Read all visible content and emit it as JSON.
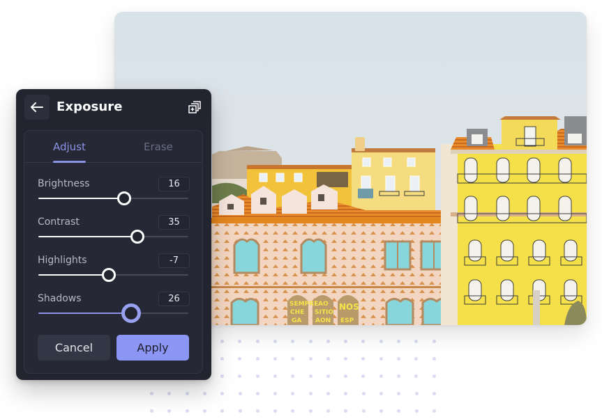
{
  "panel": {
    "title": "Exposure",
    "back_icon": "arrow-left-icon",
    "copy_icon": "duplicate-add-icon",
    "tabs": [
      {
        "label": "Adjust",
        "active": true
      },
      {
        "label": "Erase",
        "active": false
      }
    ],
    "sliders": [
      {
        "label": "Brightness",
        "value": "16",
        "position_pct": 57,
        "active": false
      },
      {
        "label": "Contrast",
        "value": "35",
        "position_pct": 66,
        "active": false
      },
      {
        "label": "Highlights",
        "value": "-7",
        "position_pct": 47,
        "active": false
      },
      {
        "label": "Shadows",
        "value": "26",
        "position_pct": 62,
        "active": true
      }
    ],
    "buttons": {
      "cancel": "Cancel",
      "apply": "Apply"
    }
  },
  "photo": {
    "description": "Colorful Lisbon building facades under pale sky",
    "sign_text": [
      "SEMPRE",
      "CHE",
      "GA",
      "AO",
      "SITIO",
      "AON",
      "NOS",
      "ESP"
    ]
  },
  "colors": {
    "accent": "#8c96f4",
    "panel_bg": "#22242f",
    "inner_bg": "#262835",
    "text_primary": "#ffffff",
    "text_muted": "#b6b9c8",
    "dot": "#d9dbf2"
  }
}
